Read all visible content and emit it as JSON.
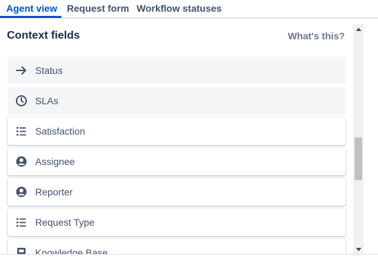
{
  "tabs": [
    {
      "label": "Agent view",
      "active": true
    },
    {
      "label": "Request form",
      "active": false
    },
    {
      "label": "Workflow statuses",
      "active": false
    }
  ],
  "section": {
    "title": "Context fields",
    "help_link": "What's this?"
  },
  "fields": [
    {
      "label": "Status",
      "icon": "arrow-right-icon",
      "locked": true
    },
    {
      "label": "SLAs",
      "icon": "clock-icon",
      "locked": true
    },
    {
      "label": "Satisfaction",
      "icon": "list-icon",
      "locked": false
    },
    {
      "label": "Assignee",
      "icon": "person-circle-icon",
      "locked": false
    },
    {
      "label": "Reporter",
      "icon": "person-circle-icon",
      "locked": false
    },
    {
      "label": "Request Type",
      "icon": "list-icon",
      "locked": false
    },
    {
      "label": "Knowledge Base",
      "icon": "book-icon",
      "locked": false
    }
  ],
  "colors": {
    "accent": "#0052cc",
    "text": "#172b4d",
    "muted": "#42526e",
    "locked_bg": "#f4f5f7"
  }
}
